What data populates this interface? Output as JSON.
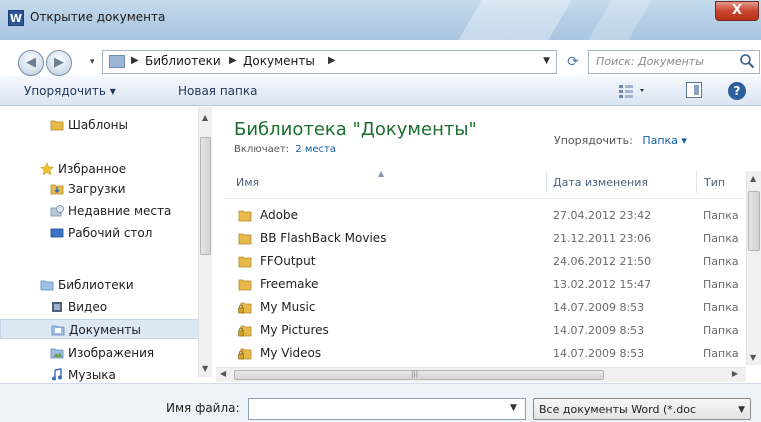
{
  "window": {
    "title": "Открытие документа",
    "app_icon": "W",
    "close": "X"
  },
  "address": {
    "crumbs": [
      "Библиотеки",
      "Документы"
    ],
    "search_placeholder": "Поиск: Документы"
  },
  "toolbar": {
    "organize": "Упорядочить ▾",
    "new_folder": "Новая папка"
  },
  "nav": {
    "items": [
      {
        "label": "Шаблоны",
        "icon": "folder-icon"
      },
      {
        "label": "Избранное",
        "icon": "star-icon"
      },
      {
        "label": "Загрузки",
        "icon": "downloads-folder-icon"
      },
      {
        "label": "Недавние места",
        "icon": "recent-places-icon"
      },
      {
        "label": "Рабочий стол",
        "icon": "desktop-icon"
      },
      {
        "label": "Библиотеки",
        "icon": "libraries-icon"
      },
      {
        "label": "Видео",
        "icon": "video-library-icon"
      },
      {
        "label": "Документы",
        "icon": "documents-library-icon"
      },
      {
        "label": "Изображения",
        "icon": "pictures-library-icon"
      },
      {
        "label": "Музыка",
        "icon": "music-library-icon"
      }
    ],
    "selected_index": 7
  },
  "library": {
    "title": "Библиотека \"Документы\"",
    "includes_label": "Включает:",
    "includes_link": "2 места",
    "arrange_label": "Упорядочить:",
    "arrange_value": "Папка ▾"
  },
  "columns": {
    "name": "Имя",
    "date": "Дата изменения",
    "type": "Тип"
  },
  "files": [
    {
      "name": "Adobe",
      "date": "27.04.2012 23:42",
      "type": "Папка",
      "icon": "folder-icon"
    },
    {
      "name": "BB FlashBack Movies",
      "date": "21.12.2011 23:06",
      "type": "Папка",
      "icon": "folder-icon"
    },
    {
      "name": "FFOutput",
      "date": "24.06.2012 21:50",
      "type": "Папка",
      "icon": "folder-icon"
    },
    {
      "name": "Freemake",
      "date": "13.02.2012 15:47",
      "type": "Папка",
      "icon": "folder-icon"
    },
    {
      "name": "My Music",
      "date": "14.07.2009 8:53",
      "type": "Папка",
      "icon": "locked-folder-icon"
    },
    {
      "name": "My Pictures",
      "date": "14.07.2009 8:53",
      "type": "Папка",
      "icon": "locked-folder-icon"
    },
    {
      "name": "My Videos",
      "date": "14.07.2009 8:53",
      "type": "Папка",
      "icon": "locked-folder-icon"
    }
  ],
  "bottom": {
    "filename_label": "Имя файла:",
    "filename_value": "",
    "filter": "Все документы Word (*.doc"
  },
  "colors": {
    "library_title": "#1b6f2e",
    "link": "#0e5ea6",
    "toolbar_text": "#1e395b"
  }
}
